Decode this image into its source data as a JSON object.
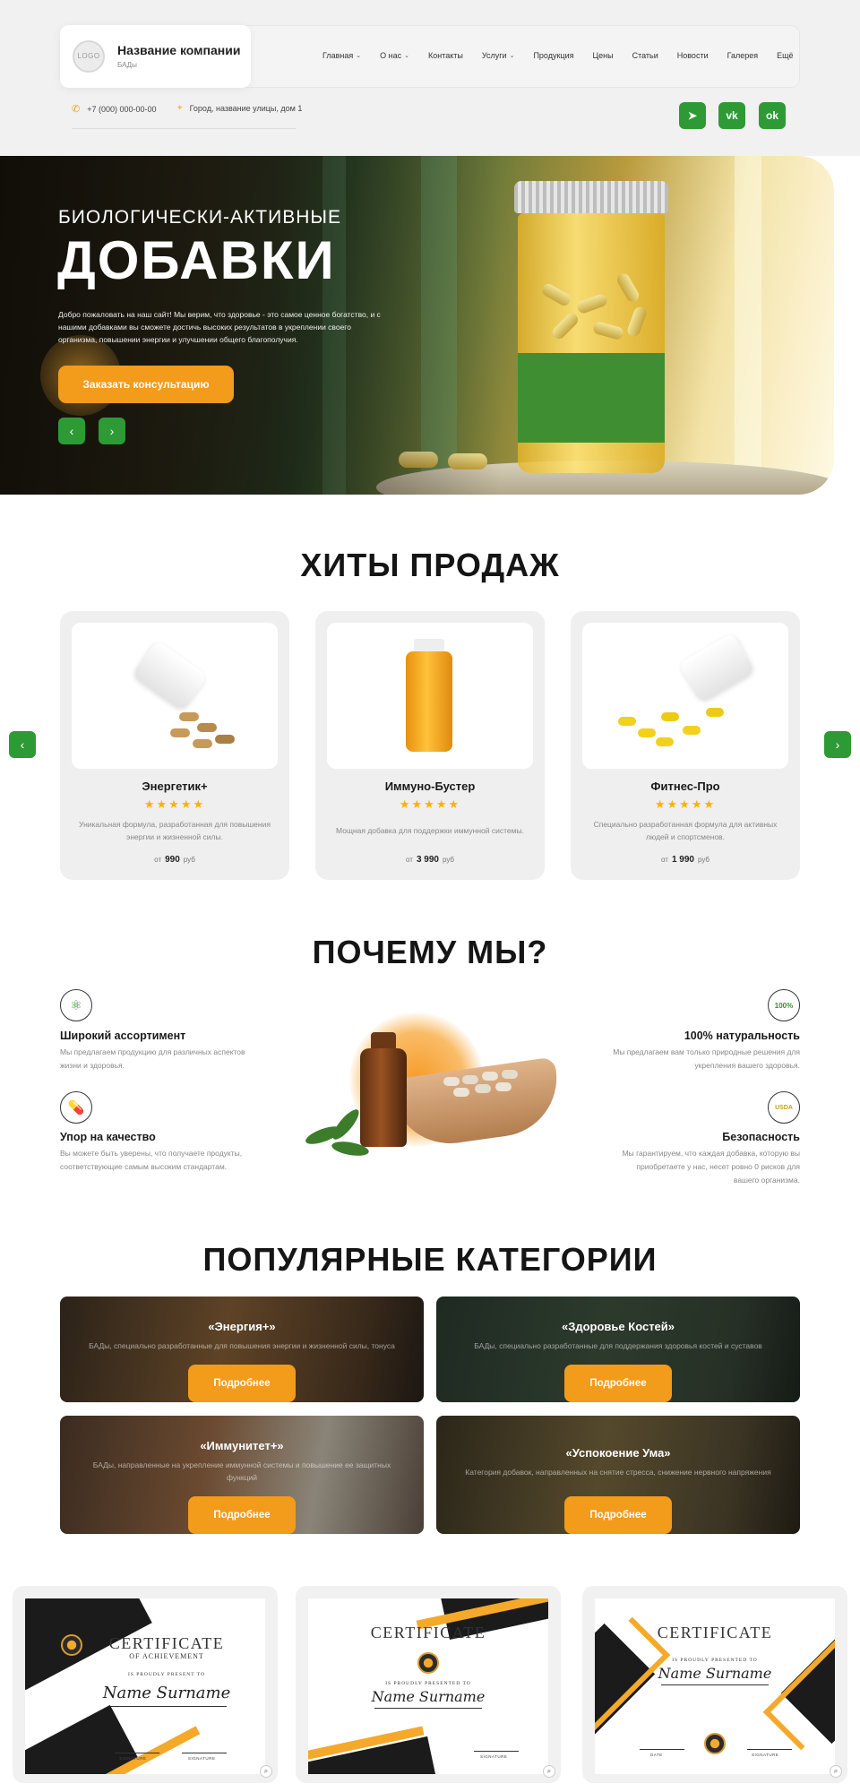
{
  "header": {
    "logo_text": "LOGO",
    "company_name": "Название компании",
    "company_sub": "БАДы",
    "nav": [
      {
        "label": "Главная",
        "has_dropdown": true
      },
      {
        "label": "О нас",
        "has_dropdown": true
      },
      {
        "label": "Контакты",
        "has_dropdown": false
      },
      {
        "label": "Услуги",
        "has_dropdown": true
      },
      {
        "label": "Продукция",
        "has_dropdown": false
      },
      {
        "label": "Цены",
        "has_dropdown": false
      },
      {
        "label": "Статьи",
        "has_dropdown": false
      },
      {
        "label": "Новости",
        "has_dropdown": false
      },
      {
        "label": "Галерея",
        "has_dropdown": false
      },
      {
        "label": "Ещё",
        "has_dropdown": false
      }
    ],
    "phone": "+7 (000) 000-00-00",
    "address": "Город, название улицы, дом 1",
    "socials": [
      "telegram-icon",
      "vk-icon",
      "odnoklassniki-icon"
    ]
  },
  "hero": {
    "subtitle": "БИОЛОГИЧЕСКИ-АКТИВНЫЕ",
    "title": "ДОБАВКИ",
    "text": "Добро пожаловать на наш сайт! Мы верим, что здоровье - это самое ценное богатство, и с нашими добавками вы сможете достичь высоких результатов в укреплении своего организма, повышении энергии и улучшении общего благополучия.",
    "button": "Заказать консультацию"
  },
  "hits": {
    "title": "ХИТЫ ПРОДАЖ",
    "products": [
      {
        "name": "Энергетик+",
        "rating": 5,
        "desc": "Уникальная формула, разработанная для повышения энергии и жизненной силы.",
        "price_prefix": "от",
        "price": "990",
        "currency": "руб"
      },
      {
        "name": "Иммуно-Бустер",
        "rating": 5,
        "desc": "Мощная добавка для поддержки иммунной системы.",
        "price_prefix": "от",
        "price": "3 990",
        "currency": "руб"
      },
      {
        "name": "Фитнес-Про",
        "rating": 5,
        "desc": "Специально разработанная формула для активных людей и спортсменов.",
        "price_prefix": "от",
        "price": "1 990",
        "currency": "руб"
      }
    ]
  },
  "why": {
    "title": "ПОЧЕМУ МЫ?",
    "items": [
      {
        "icon": "molecule-icon",
        "title": "Широкий ассортимент",
        "text": "Мы предлагаем продукцию для различных аспектов жизни и здоровья."
      },
      {
        "icon": "pill-icon",
        "title": "Упор на качество",
        "text": "Вы можете быть уверены, что получаете продукты, соответствующие самым высоким стандартам."
      },
      {
        "icon": "natural-badge-icon",
        "badge": "100%",
        "title": "100% натуральность",
        "text": "Мы предлагаем вам только природные решения для укрепления вашего здоровья."
      },
      {
        "icon": "usda-organic-icon",
        "badge": "USDA",
        "title": "Безопасность",
        "text": "Мы гарантируем, что каждая добавка, которую вы приобретаете у нас, несет ровно 0 рисков для вашего организма."
      }
    ]
  },
  "categories": {
    "title": "ПОПУЛЯРНЫЕ КАТЕГОРИИ",
    "button": "Подробнее",
    "items": [
      {
        "title": "«Энергия+»",
        "text": "БАДы, специально разработанные для повышения энергии и жизненной силы, тонуса"
      },
      {
        "title": "«Здоровье Костей»",
        "text": "БАДы, специально разработанные для поддержания здоровья костей и суставов"
      },
      {
        "title": "«Иммунитет+»",
        "text": "БАДы, направленные на укрепление иммунной системы и повышение ее защитных функций"
      },
      {
        "title": "«Успокоение Ума»",
        "text": "Категория добавок, направленных на снятие стресса, снижение нервного напряжения"
      }
    ]
  },
  "certificates": [
    {
      "heading": "CERTIFICATE",
      "sub": "OF ACHIEVEMENT",
      "presented": "IS PROUDLY PRESENT TO",
      "name": "Name Surname",
      "sign1": "SIGNATURE",
      "sign2": "SIGNATURE"
    },
    {
      "heading": "CERTIFICATE",
      "sub": "",
      "presented": "IS PROUDLY PRESENTED TO",
      "name": "Name Surname",
      "sign1": "",
      "sign2": "SIGNATURE"
    },
    {
      "heading": "CERTIFICATE",
      "sub": "",
      "presented": "IS PROUDLY PRESENTED TO",
      "name": "Name Surname",
      "sign1": "DATE",
      "sign2": "SIGNATURE"
    }
  ],
  "colors": {
    "accent_green": "#2e9a35",
    "accent_orange": "#f39b1b",
    "star": "#f5b400"
  }
}
